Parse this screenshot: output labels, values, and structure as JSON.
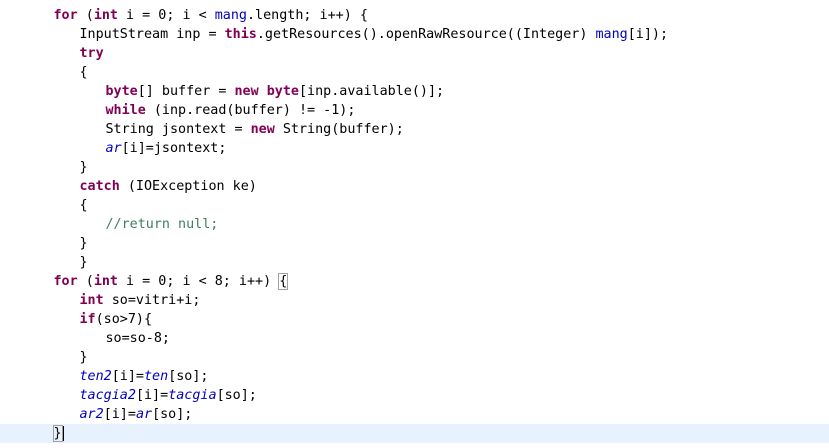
{
  "editor": {
    "lines": [
      {
        "indent": 7,
        "tokens": [
          {
            "t": "for",
            "c": "kw"
          },
          {
            "t": " (",
            "c": "plain"
          },
          {
            "t": "int",
            "c": "kw"
          },
          {
            "t": " i = 0; i < ",
            "c": "plain"
          },
          {
            "t": "mang",
            "c": "field"
          },
          {
            "t": ".length; i++) {",
            "c": "plain"
          }
        ]
      },
      {
        "indent": 11,
        "tokens": [
          {
            "t": "InputStream inp = ",
            "c": "plain"
          },
          {
            "t": "this",
            "c": "kw"
          },
          {
            "t": ".getResources().openRawResource((Integer) ",
            "c": "plain"
          },
          {
            "t": "mang",
            "c": "field"
          },
          {
            "t": "[i]);",
            "c": "plain"
          }
        ]
      },
      {
        "indent": 11,
        "tokens": [
          {
            "t": "try",
            "c": "kw"
          }
        ]
      },
      {
        "indent": 11,
        "tokens": [
          {
            "t": "{",
            "c": "plain"
          }
        ]
      },
      {
        "indent": 15,
        "tokens": [
          {
            "t": "byte",
            "c": "kw"
          },
          {
            "t": "[] buffer = ",
            "c": "plain"
          },
          {
            "t": "new",
            "c": "kw"
          },
          {
            "t": " ",
            "c": "plain"
          },
          {
            "t": "byte",
            "c": "kw"
          },
          {
            "t": "[inp.available()];",
            "c": "plain"
          }
        ]
      },
      {
        "indent": 15,
        "tokens": [
          {
            "t": "while",
            "c": "kw"
          },
          {
            "t": " (inp.read(buffer) != -1);",
            "c": "plain"
          }
        ]
      },
      {
        "indent": 15,
        "tokens": [
          {
            "t": "String jsontext = ",
            "c": "plain"
          },
          {
            "t": "new",
            "c": "kw"
          },
          {
            "t": " String(buffer);",
            "c": "plain"
          }
        ]
      },
      {
        "indent": 15,
        "tokens": [
          {
            "t": "ar",
            "c": "fieldi"
          },
          {
            "t": "[i]=jsontext;",
            "c": "plain"
          }
        ]
      },
      {
        "indent": 11,
        "tokens": [
          {
            "t": "}",
            "c": "plain"
          }
        ]
      },
      {
        "indent": 11,
        "tokens": [
          {
            "t": "catch",
            "c": "kw"
          },
          {
            "t": " (IOException ke)",
            "c": "plain"
          }
        ]
      },
      {
        "indent": 11,
        "tokens": [
          {
            "t": "{",
            "c": "plain"
          }
        ]
      },
      {
        "indent": 15,
        "tokens": [
          {
            "t": "//return null;",
            "c": "comment"
          }
        ]
      },
      {
        "indent": 11,
        "tokens": [
          {
            "t": "}",
            "c": "plain"
          }
        ]
      },
      {
        "indent": 11,
        "tokens": [
          {
            "t": "}",
            "c": "plain"
          }
        ]
      },
      {
        "indent": 7,
        "tokens": [
          {
            "t": "for",
            "c": "kw"
          },
          {
            "t": " (",
            "c": "plain"
          },
          {
            "t": "int",
            "c": "kw"
          },
          {
            "t": " i = 0; i < 8; i++) ",
            "c": "plain"
          },
          {
            "t": "{",
            "c": "plain",
            "box": true
          }
        ]
      },
      {
        "indent": 11,
        "tokens": [
          {
            "t": "int",
            "c": "kw"
          },
          {
            "t": " so=vitri+i;",
            "c": "plain"
          }
        ]
      },
      {
        "indent": 11,
        "tokens": [
          {
            "t": "if",
            "c": "kw"
          },
          {
            "t": "(so>7){",
            "c": "plain"
          }
        ]
      },
      {
        "indent": 15,
        "tokens": [
          {
            "t": "so=so-8;",
            "c": "plain"
          }
        ]
      },
      {
        "indent": 11,
        "tokens": [
          {
            "t": "}",
            "c": "plain"
          }
        ]
      },
      {
        "indent": 11,
        "tokens": [
          {
            "t": "ten2",
            "c": "fieldi"
          },
          {
            "t": "[i]=",
            "c": "plain"
          },
          {
            "t": "ten",
            "c": "fieldi"
          },
          {
            "t": "[so];",
            "c": "plain"
          }
        ]
      },
      {
        "indent": 11,
        "tokens": [
          {
            "t": "tacgia2",
            "c": "fieldi"
          },
          {
            "t": "[i]=",
            "c": "plain"
          },
          {
            "t": "tacgia",
            "c": "fieldi"
          },
          {
            "t": "[so];",
            "c": "plain"
          }
        ]
      },
      {
        "indent": 11,
        "tokens": [
          {
            "t": "ar2",
            "c": "fieldi"
          },
          {
            "t": "[i]=",
            "c": "plain"
          },
          {
            "t": "ar",
            "c": "fieldi"
          },
          {
            "t": "[so];",
            "c": "plain"
          }
        ]
      },
      {
        "indent": 7,
        "tokens": [
          {
            "t": "}",
            "c": "plain",
            "box": true
          }
        ],
        "caret": true
      }
    ],
    "colors": {
      "keyword": "#7f0055",
      "field": "#0000c0",
      "comment": "#3f7f5f",
      "current_line": "#e8f2fe",
      "background": "#ffffff"
    }
  }
}
